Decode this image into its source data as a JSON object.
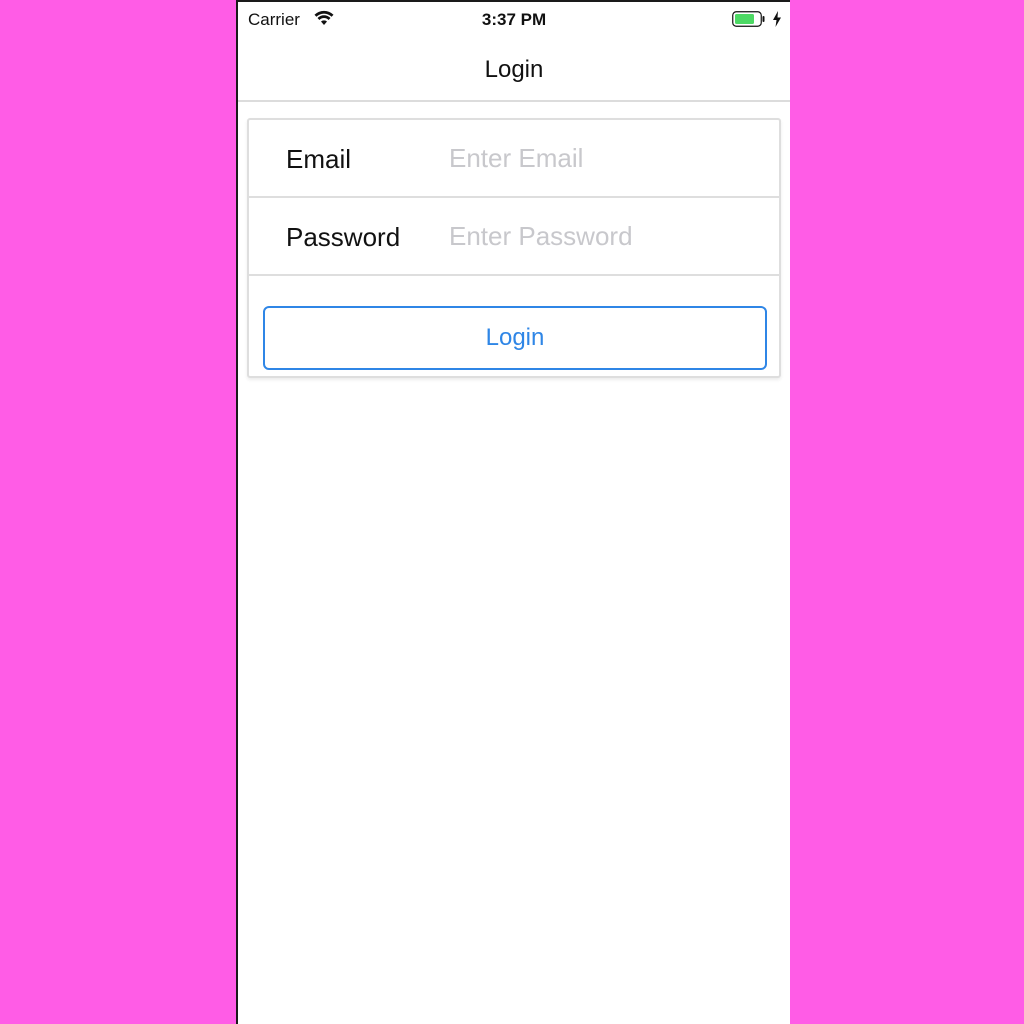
{
  "status_bar": {
    "carrier": "Carrier",
    "time": "3:37 PM",
    "wifi_icon": "wifi-icon",
    "battery_icon": "battery-charging-icon",
    "battery_color": "#4cd964"
  },
  "nav": {
    "title": "Login"
  },
  "form": {
    "email": {
      "label": "Email",
      "placeholder": "Enter Email",
      "value": ""
    },
    "password": {
      "label": "Password",
      "placeholder": "Enter Password",
      "value": ""
    },
    "login_button_label": "Login"
  },
  "colors": {
    "background": "#ff5ce6",
    "accent": "#2f86e6",
    "placeholder": "#c8c8cc"
  }
}
